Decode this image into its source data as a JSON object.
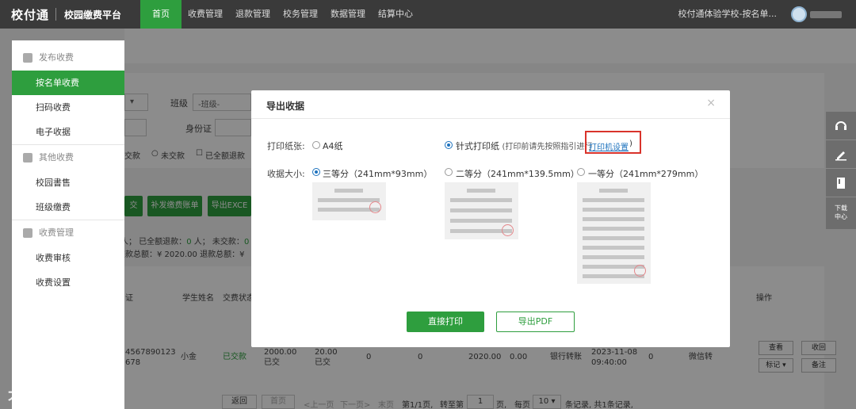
{
  "header": {
    "logo": "校付通",
    "platform": "校园缴费平台",
    "nav": [
      "首页",
      "收费管理",
      "退款管理",
      "校务管理",
      "数据管理",
      "结算中心"
    ],
    "school": "校付通体验学校-按名单..."
  },
  "sidebar": {
    "groups": [
      {
        "label": "发布收费",
        "items": [
          "按名单收费",
          "扫码收费",
          "电子收据"
        ]
      },
      {
        "label": "其他收费",
        "items": [
          "校园書售",
          "班级缴费"
        ]
      },
      {
        "label": "收费管理",
        "items": [
          "收费审核",
          "收费设置"
        ]
      }
    ]
  },
  "background": {
    "class_label": "班级",
    "class_select": "-班级-",
    "id_label": "身份证",
    "filters": [
      "交款",
      "未交款",
      "已全额退款"
    ],
    "buttons": [
      "交",
      "补发缴费账单",
      "导出EXCE"
    ],
    "summary1": "人；  已全额退款：",
    "summary1_n": "0",
    "summary1_b": "人；  未交款：",
    "summary1_c": "0",
    "summary2": "交款总额：¥ 2020.00    退款总额：¥",
    "table_headers": [
      "证",
      "学生姓名",
      "交费状态",
      "操作"
    ],
    "row": {
      "id": "4567890123\n678",
      "name": "小金",
      "status": "已交款",
      "amount1": "2000.00\n已交",
      "amount2": "20.00\n已交",
      "c1": "0",
      "c2": "0",
      "total": "2020.00",
      "refund": "0.00",
      "method": "银行转账",
      "time": "2023-11-08\n09:40:00",
      "c3": "0",
      "pay": "微信转",
      "ops": [
        "查看",
        "收回",
        "标记",
        "备注"
      ]
    },
    "pager": {
      "back": "返回",
      "first": "首页",
      "prev": "<上一页",
      "next": "下一页>",
      "last": "末页",
      "page_info": "第1/1页,",
      "goto": "转至第",
      "goto_val": "1",
      "page_unit": "页,",
      "per": "每页",
      "per_val": "10",
      "total": "条记录,  共1条记录,"
    }
  },
  "tools": {
    "download": "下载\n中心"
  },
  "modal": {
    "title": "导出收据",
    "paper_label": "打印纸张:",
    "paper_a4": "A4纸",
    "paper_needle": "针式打印纸",
    "paper_note": "(打印前请先按照指引进行",
    "paper_link": "打印机设置",
    "paper_note_end": ")",
    "size_label": "收据大小:",
    "sizes": [
      "三等分（241mm*93mm）",
      "二等分（241mm*139.5mm）",
      "一等分（241mm*279mm）"
    ],
    "print_btn": "直接打印",
    "pdf_btn": "导出PDF"
  },
  "watermark": "大数跨境",
  "colors": {
    "accent": "#2e9e3e",
    "link": "#1e73be",
    "highlight": "#d9332b"
  }
}
